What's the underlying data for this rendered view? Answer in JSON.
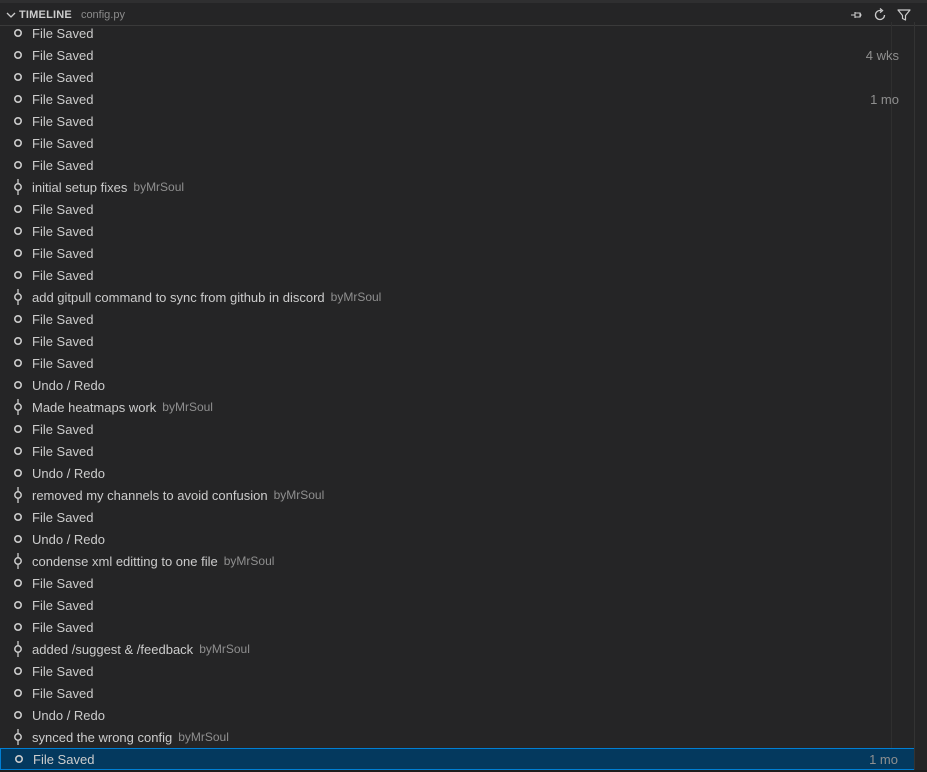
{
  "header": {
    "title": "TIMELINE",
    "file": "config.py",
    "actions": [
      {
        "name": "pin-icon"
      },
      {
        "name": "refresh-icon"
      },
      {
        "name": "filter-icon"
      }
    ]
  },
  "colors": {
    "background": "#252526",
    "selection_bg": "#04395e",
    "selection_border": "#007fd4",
    "text": "#cccccc",
    "muted": "#8f8f8f"
  },
  "items": [
    {
      "label": "File Saved",
      "type": "save",
      "author": "",
      "time": ""
    },
    {
      "label": "File Saved",
      "type": "save",
      "author": "",
      "time": "4 wks"
    },
    {
      "label": "File Saved",
      "type": "save",
      "author": "",
      "time": ""
    },
    {
      "label": "File Saved",
      "type": "save",
      "author": "",
      "time": "1 mo"
    },
    {
      "label": "File Saved",
      "type": "save",
      "author": "",
      "time": ""
    },
    {
      "label": "File Saved",
      "type": "save",
      "author": "",
      "time": ""
    },
    {
      "label": "File Saved",
      "type": "save",
      "author": "",
      "time": ""
    },
    {
      "label": "initial setup fixes",
      "type": "commit",
      "author": "byMrSoul",
      "time": ""
    },
    {
      "label": "File Saved",
      "type": "save",
      "author": "",
      "time": ""
    },
    {
      "label": "File Saved",
      "type": "save",
      "author": "",
      "time": ""
    },
    {
      "label": "File Saved",
      "type": "save",
      "author": "",
      "time": ""
    },
    {
      "label": "File Saved",
      "type": "save",
      "author": "",
      "time": ""
    },
    {
      "label": "add gitpull command to sync from github in discord",
      "type": "commit",
      "author": "byMrSoul",
      "time": ""
    },
    {
      "label": "File Saved",
      "type": "save",
      "author": "",
      "time": ""
    },
    {
      "label": "File Saved",
      "type": "save",
      "author": "",
      "time": ""
    },
    {
      "label": "File Saved",
      "type": "save",
      "author": "",
      "time": ""
    },
    {
      "label": "Undo / Redo",
      "type": "save",
      "author": "",
      "time": ""
    },
    {
      "label": "Made heatmaps work",
      "type": "commit",
      "author": "byMrSoul",
      "time": ""
    },
    {
      "label": "File Saved",
      "type": "save",
      "author": "",
      "time": ""
    },
    {
      "label": "File Saved",
      "type": "save",
      "author": "",
      "time": ""
    },
    {
      "label": "Undo / Redo",
      "type": "save",
      "author": "",
      "time": ""
    },
    {
      "label": "removed my channels to avoid confusion",
      "type": "commit",
      "author": "byMrSoul",
      "time": ""
    },
    {
      "label": "File Saved",
      "type": "save",
      "author": "",
      "time": ""
    },
    {
      "label": "Undo / Redo",
      "type": "save",
      "author": "",
      "time": ""
    },
    {
      "label": "condense xml editting to one file",
      "type": "commit",
      "author": "byMrSoul",
      "time": ""
    },
    {
      "label": "File Saved",
      "type": "save",
      "author": "",
      "time": ""
    },
    {
      "label": "File Saved",
      "type": "save",
      "author": "",
      "time": ""
    },
    {
      "label": "File Saved",
      "type": "save",
      "author": "",
      "time": ""
    },
    {
      "label": "added /suggest & /feedback",
      "type": "commit",
      "author": "byMrSoul",
      "time": ""
    },
    {
      "label": "File Saved",
      "type": "save",
      "author": "",
      "time": ""
    },
    {
      "label": "File Saved",
      "type": "save",
      "author": "",
      "time": ""
    },
    {
      "label": "Undo / Redo",
      "type": "save",
      "author": "",
      "time": ""
    },
    {
      "label": "synced the wrong config",
      "type": "commit",
      "author": "byMrSoul",
      "time": ""
    },
    {
      "label": "File Saved",
      "type": "save",
      "author": "",
      "time": "1 mo",
      "selected": true
    }
  ]
}
